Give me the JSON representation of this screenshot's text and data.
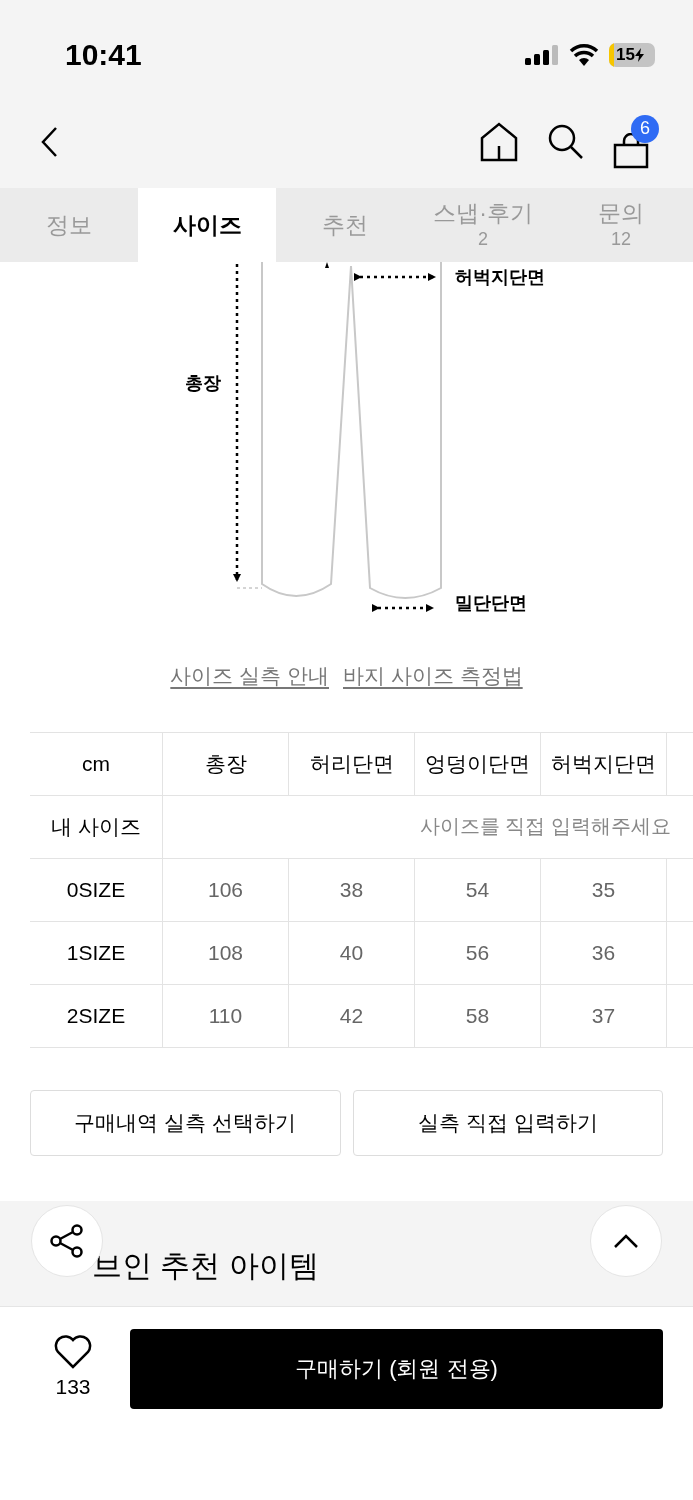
{
  "status_bar": {
    "time": "10:41",
    "battery": "15"
  },
  "nav": {
    "cart_count": "6"
  },
  "tabs": [
    {
      "label": "정보",
      "selected": false
    },
    {
      "label": "사이즈",
      "selected": true
    },
    {
      "label": "추천",
      "selected": false
    },
    {
      "label": "스냅·후기",
      "count": "2",
      "selected": false
    },
    {
      "label": "문의",
      "count": "12",
      "selected": false
    }
  ],
  "diagram": {
    "thigh_label": "허벅지단면",
    "length_label": "총장",
    "hem_label": "밀단단면"
  },
  "size_links": [
    "사이즈 실측 안내",
    "바지 사이즈 측정법"
  ],
  "size_table": {
    "columns": [
      "cm",
      "총장",
      "허리단면",
      "엉덩이단면",
      "허벅지단면"
    ],
    "my_size": {
      "label": "내 사이즈",
      "placeholder": "사이즈를 직접 입력해주세요"
    },
    "rows": [
      {
        "size": "0SIZE",
        "values": [
          "106",
          "38",
          "54",
          "35"
        ]
      },
      {
        "size": "1SIZE",
        "values": [
          "108",
          "40",
          "56",
          "36"
        ]
      },
      {
        "size": "2SIZE",
        "values": [
          "110",
          "42",
          "58",
          "37"
        ]
      }
    ]
  },
  "size_actions": [
    "구매내역 실측 선택하기",
    "실측 직접 입력하기"
  ],
  "recommend": {
    "title": "브인 추천 아이템"
  },
  "bottom_bar": {
    "likes": "133",
    "buy_label": "구매하기 (회원 전용)"
  }
}
